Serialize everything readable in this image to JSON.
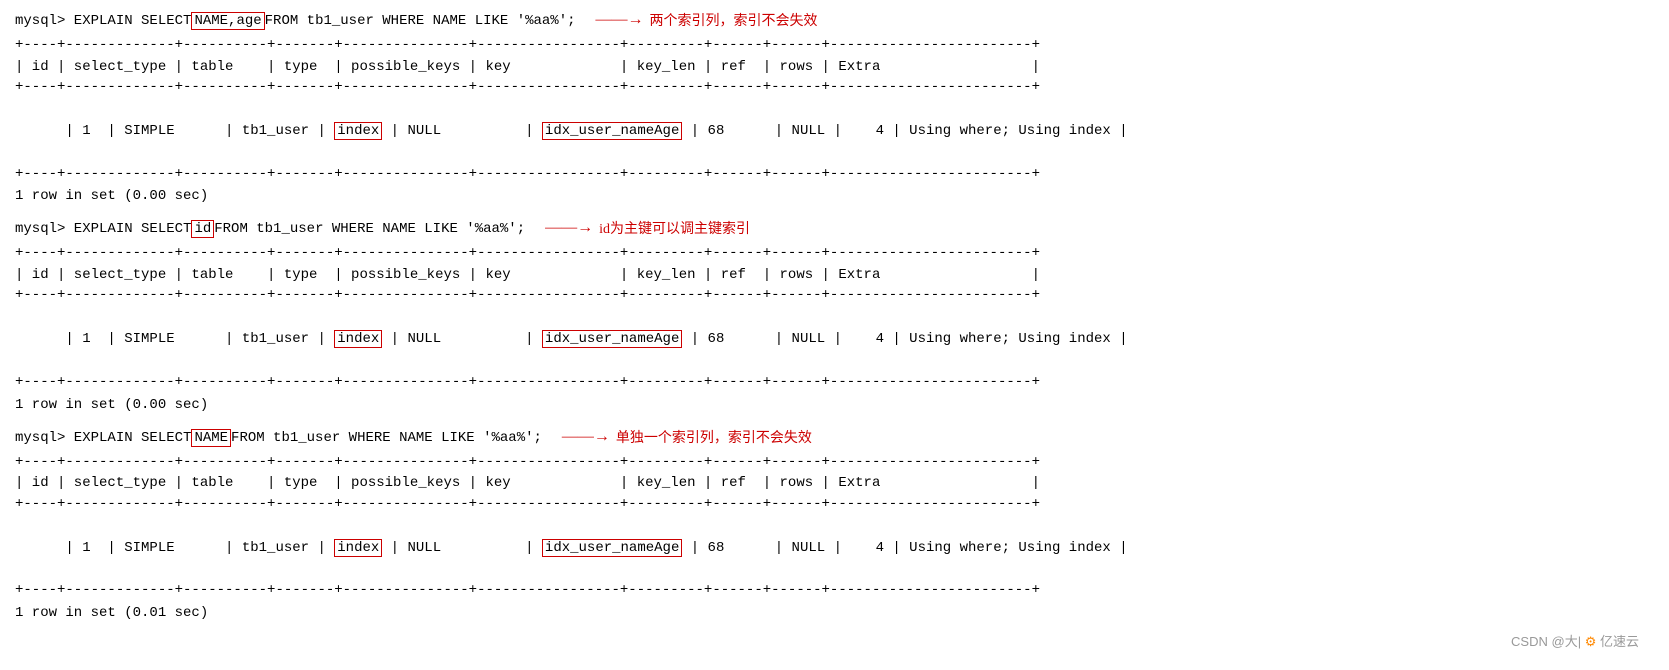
{
  "sections": [
    {
      "id": "section1",
      "sql_prefix": "mysql> EXPLAIN SELECT ",
      "sql_highlight": "NAME,age",
      "sql_suffix": "  FROM tb1_user WHERE NAME LIKE '%aa%';",
      "annotation_arrow": "——→",
      "annotation_text": "两个索引列，索引不会失效",
      "divider": "+----+-------------+----------+-------+---------------+-----------------+---------+------+------+------------------------+",
      "header": "| id | select_type | table    | type  | possible_keys | key             | key_len | ref  | rows | Extra                  |",
      "divider2": "+----+-------------+----------+-------+---------------+-----------------+---------+------+------+------------------------+",
      "data_row_pre": "| 1  | SIMPLE      | tb1_user | ",
      "data_type": "index",
      "data_mid": " | NULL          | ",
      "data_key": "idx_user_nameAge",
      "data_post": " | 68      | NULL |    4 | Using where; Using index |",
      "divider3": "+----+-------------+----------+-------+---------------+-----------------+---------+------+------+------------------------+",
      "result": "1 row in set (0.00 sec)"
    },
    {
      "id": "section2",
      "sql_prefix": "mysql> EXPLAIN SELECT ",
      "sql_highlight": "id",
      "sql_suffix": "  FROM tb1_user WHERE NAME LIKE '%aa%';",
      "annotation_arrow": "——→",
      "annotation_text": "id为主键可以调主键索引",
      "divider": "+----+-------------+----------+-------+---------------+-----------------+---------+------+------+------------------------+",
      "header": "| id | select_type | table    | type  | possible_keys | key             | key_len | ref  | rows | Extra                  |",
      "divider2": "+----+-------------+----------+-------+---------------+-----------------+---------+------+------+------------------------+",
      "data_row_pre": "| 1  | SIMPLE      | tb1_user | ",
      "data_type": "index",
      "data_mid": " | NULL          | ",
      "data_key": "idx_user_nameAge",
      "data_post": " | 68      | NULL |    4 | Using where; Using index |",
      "divider3": "+----+-------------+----------+-------+---------------+-----------------+---------+------+------+------------------------+",
      "result": "1 row in set (0.00 sec)"
    },
    {
      "id": "section3",
      "sql_prefix": "mysql> EXPLAIN SELECT ",
      "sql_highlight": "NAME",
      "sql_suffix": "   FROM tb1_user WHERE NAME LIKE '%aa%';",
      "annotation_arrow": "——→",
      "annotation_text": "单独一个索引列，索引不会失效",
      "divider": "+----+-------------+----------+-------+---------------+-----------------+---------+------+------+------------------------+",
      "header": "| id | select_type | table    | type  | possible_keys | key             | key_len | ref  | rows | Extra                  |",
      "divider2": "+----+-------------+----------+-------+---------------+-----------------+---------+------+------+------------------------+",
      "data_row_pre": "| 1  | SIMPLE      | tb1_user | ",
      "data_type": "index",
      "data_mid": " | NULL          | ",
      "data_key": "idx_user_nameAge",
      "data_post": " | 68      | NULL |    4 | Using where; Using index |",
      "divider3": "+----+-------------+----------+-------+---------------+-----------------+---------+------+------+------------------------+",
      "result": "1 row in set (0.01 sec)"
    }
  ],
  "watermark": {
    "csdn": "CSDN @大|",
    "icon": "⚙",
    "yisu": "亿速云"
  }
}
